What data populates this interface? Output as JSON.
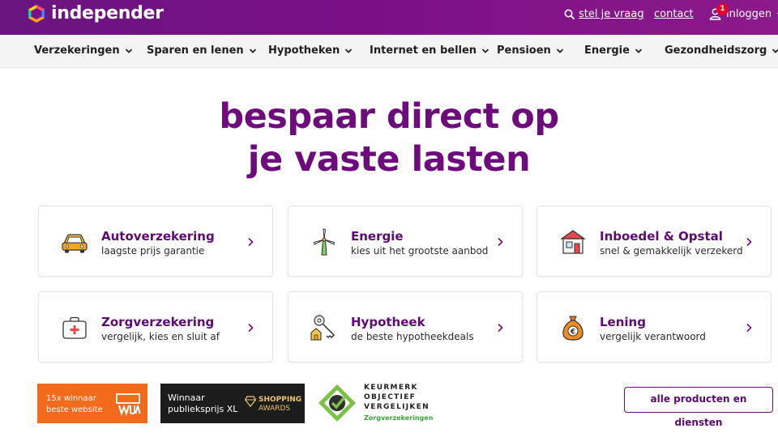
{
  "brand": {
    "name": "independer",
    "accent": "#6d0b7c"
  },
  "top": {
    "ask_label": "stel je vraag",
    "contact_label": "contact",
    "login_label": "inloggen",
    "notifications": "1"
  },
  "nav": {
    "items": [
      {
        "label": "Verzekeringen"
      },
      {
        "label": "Sparen en lenen"
      },
      {
        "label": "Hypotheken"
      },
      {
        "label": "Internet en bellen"
      },
      {
        "label": "Pensioen"
      },
      {
        "label": "Energie"
      },
      {
        "label": "Gezondheidszorg"
      }
    ]
  },
  "hero": {
    "line1": "bespaar direct op",
    "line2": "je vaste lasten"
  },
  "cards": [
    {
      "title": "Autoverzekering",
      "subtitle": "laagste prijs garantie",
      "icon": "car-icon"
    },
    {
      "title": "Energie",
      "subtitle": "kies uit het grootste aanbod",
      "icon": "wind-turbine-icon"
    },
    {
      "title": "Inboedel & Opstal",
      "subtitle": "snel & gemakkelijk verzekerd",
      "icon": "house-icon"
    },
    {
      "title": "Zorgverzekering",
      "subtitle": "vergelijk, kies en sluit af",
      "icon": "medical-bag-icon"
    },
    {
      "title": "Hypotheek",
      "subtitle": "de beste hypotheekdeals",
      "icon": "house-key-icon"
    },
    {
      "title": "Lening",
      "subtitle": "vergelijk verantwoord",
      "icon": "money-bag-icon"
    }
  ],
  "awards": {
    "wua": {
      "line1": "15x winnaar",
      "line2": "beste website"
    },
    "shopping": {
      "line1": "Winnaar",
      "line2": "publieksprijs XL",
      "mark1": "SHOPPING",
      "mark2": "AWARDS"
    },
    "keurmerk": {
      "line1": "KEURMERK",
      "line2": "OBJECTIEF",
      "line3": "VERGELIJKEN",
      "line4": "Zorgverzekeringen"
    }
  },
  "all_button_label": "alle producten en diensten"
}
